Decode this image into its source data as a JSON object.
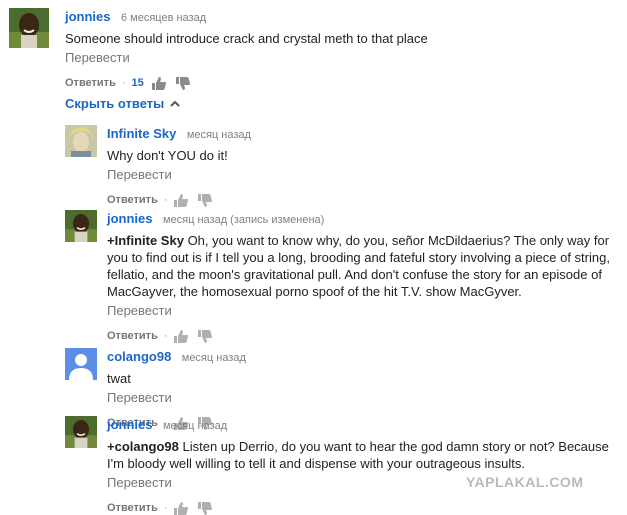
{
  "top_comment": {
    "author": "jonnies",
    "time": "6 месяцев назад",
    "text": "Someone should introduce crack and crystal meth to that place",
    "translate": "Перевести",
    "reply": "Ответить",
    "likes": "15"
  },
  "hide_replies": "Скрыть ответы",
  "replies": [
    {
      "author": "Infinite Sky",
      "time": "месяц назад",
      "text": "Why don't YOU do it!",
      "translate": "Перевести",
      "reply": "Ответить"
    },
    {
      "author": "jonnies",
      "time": "месяц назад (запись изменена)",
      "mention": "+Infinite Sky",
      "text": " Oh, you want to know why, do you, señor McDildaerius? The only way for you to find out is if I tell you a long, brooding and fateful story involving a piece of string, fellatio, and the moon's gravitational pull. And don't confuse the story for an episode of MacGayver, the homosexual porno spoof of the hit T.V. show MacGyver.",
      "translate": "Перевести",
      "reply": "Ответить"
    },
    {
      "author": "colango98",
      "time": "месяц назад",
      "text": "twat",
      "translate": "Перевести",
      "reply": "Ответить"
    },
    {
      "author": "jonnies",
      "time": "месяц назад",
      "mention": "+colango98",
      "text": " Listen up Derrio, do you want to hear the god damn story or not? Because I'm bloody well willing to tell it and dispense with your outrageous insults.",
      "translate": "Перевести",
      "reply": "Ответить"
    }
  ],
  "watermark": "YAPLAKAL.COM",
  "colors": {
    "link": "#1a67c7",
    "muted": "#767676",
    "text": "#222222"
  },
  "icons": {
    "like": "thumbs-up-icon",
    "dislike": "thumbs-down-icon",
    "collapse": "chevron-up-icon"
  }
}
